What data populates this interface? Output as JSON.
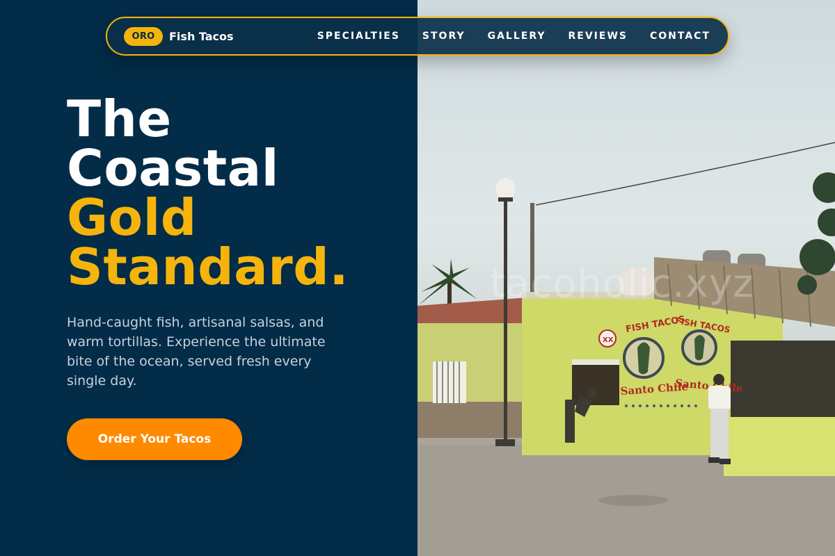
{
  "nav": {
    "badge": "ORO",
    "brand_name": "Fish Tacos",
    "links": [
      "SPECIALTIES",
      "STORY",
      "GALLERY",
      "REVIEWS",
      "CONTACT"
    ]
  },
  "hero": {
    "title_lines": [
      "The",
      "Coastal",
      "Gold",
      "Standard."
    ],
    "description": "Hand-caught fish, artisanal salsas, and warm tortillas. Experience the ultimate bite of the ocean, served fresh every single day.",
    "cta_label": "Order Your Tacos"
  },
  "photo": {
    "subject": "fish-taco-stand-photo",
    "watermark": "tacoholic.xyz",
    "signs": [
      "FISH TACOS",
      "Santo Chile",
      "XX"
    ]
  },
  "colors": {
    "navy": "#022c48",
    "gold": "#f5b40c",
    "orange": "#ff8a00",
    "text_muted": "#c6d2de"
  }
}
